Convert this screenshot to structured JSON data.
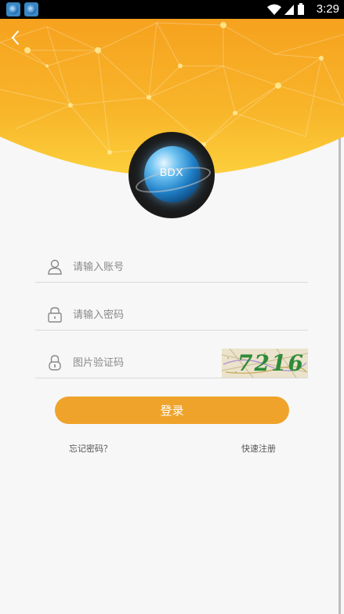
{
  "status_bar": {
    "time": "3:29",
    "left_icons": [
      "app-notification-icon",
      "app-notification-icon"
    ],
    "right_icons": [
      "wifi-icon",
      "signal-icon",
      "battery-icon"
    ]
  },
  "header": {
    "back_icon": "chevron-left-icon",
    "background_color": "#f6a623"
  },
  "logo": {
    "text": "BDX"
  },
  "form": {
    "account": {
      "icon": "user-icon",
      "placeholder": "请输入账号"
    },
    "password": {
      "icon": "lock-icon",
      "placeholder": "请输入密码"
    },
    "captcha": {
      "icon": "padlock-icon",
      "placeholder": "图片验证码",
      "image_text": "7216"
    },
    "login_label": "登录",
    "forgot_password_label": "忘记密码？",
    "quick_register_label": "快速注册"
  },
  "colors": {
    "accent": "#efa32b",
    "page_bg": "#f7f7f7",
    "divider": "#d9d9d9"
  }
}
